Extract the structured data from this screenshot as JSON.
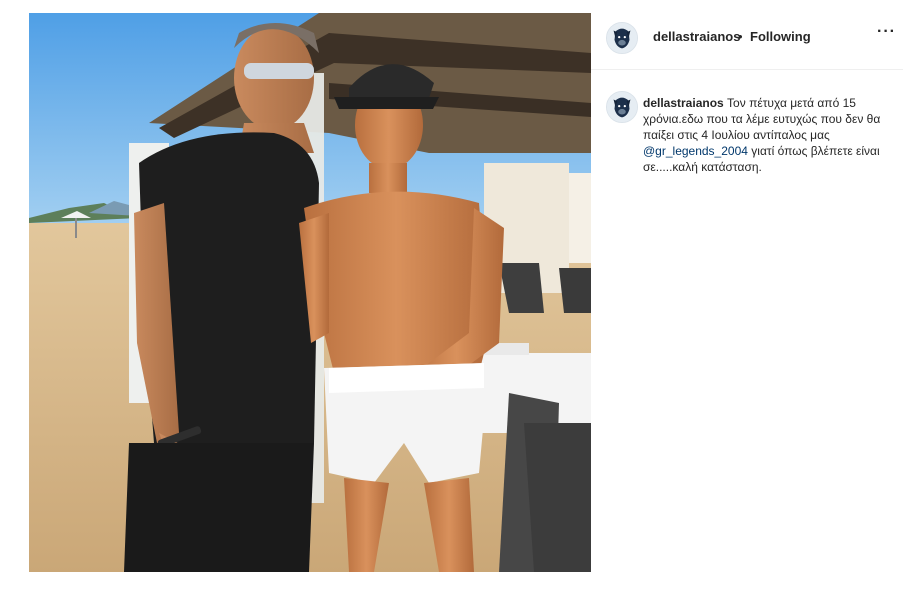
{
  "post": {
    "image_alt": "Two men posing together on a sunny beach terrace"
  },
  "header": {
    "username": "dellastraianos",
    "separator": "•",
    "follow_state": "Following",
    "more_label": "···"
  },
  "caption": {
    "username": "dellastraianos",
    "text_before": "Τον πέτυχα μετά από 15 χρόνια.εδω που τα λέμε ευτυχώς που δεν θα παίξει στις 4 Ιουλίου αντίπαλος μας",
    "mention": "@gr_legends_2004",
    "text_after": "γιατί όπως βλέπετε είναι σε.....καλή κατάσταση."
  },
  "colors": {
    "text": "#262626",
    "mention": "#00376b",
    "divider": "#efefef"
  }
}
